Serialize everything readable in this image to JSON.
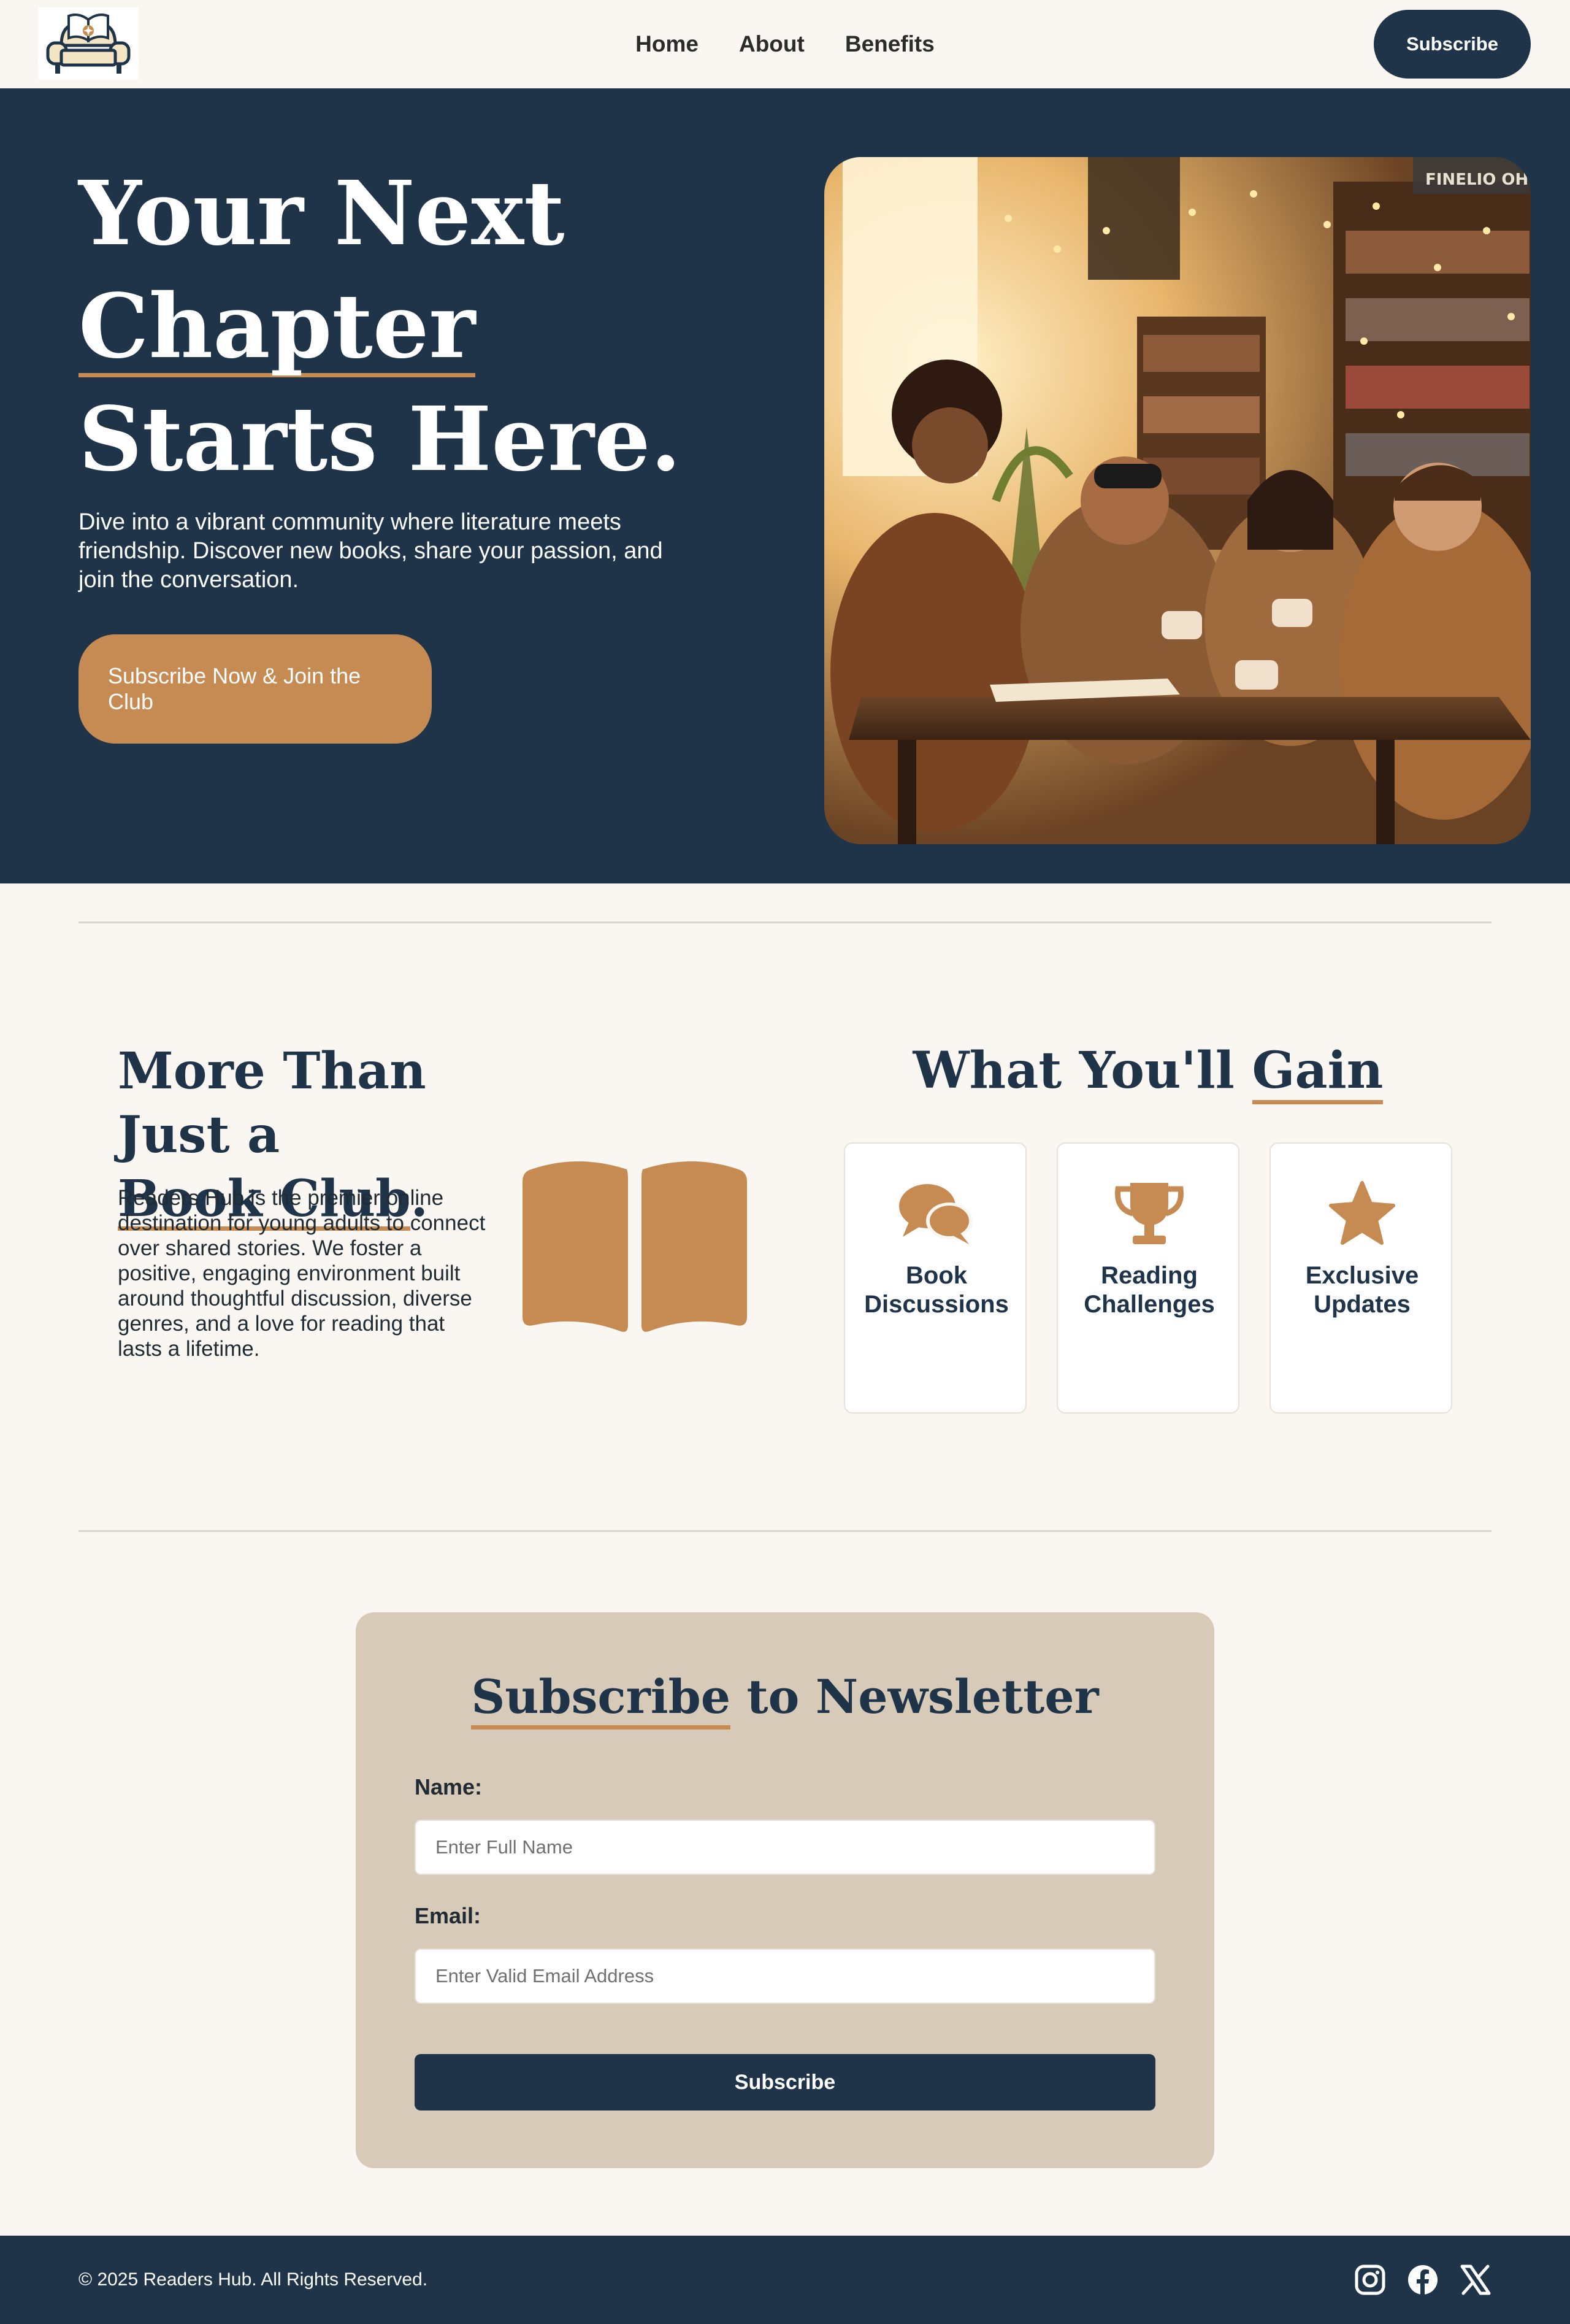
{
  "nav": {
    "logo_name": "armchair-book-logo",
    "links": [
      "Home",
      "About",
      "Benefits"
    ],
    "subscribe_label": "Subscribe"
  },
  "hero": {
    "title_line1": "Your Next",
    "title_line2": "Chapter",
    "title_line3": "Starts Here.",
    "subtitle": "Dive into a vibrant community where literature meets friendship. Discover new books, share your passion, and join the conversation.",
    "cta_label": "Subscribe Now & Join the Club",
    "image_sign_text": "FINELIO OH"
  },
  "about": {
    "title_part1": "More Than Just a ",
    "title_highlight": "Book Club",
    "title_end": ".",
    "text": "Readers Hub is the premier online destination for young adults to connect over shared stories. We foster a positive, engaging environment built around thoughtful discussion, diverse genres, and a love for reading that lasts a lifetime.",
    "icon": "open-book-icon"
  },
  "gain": {
    "title_part1": "What You'll ",
    "title_highlight": "Gain",
    "cards": [
      {
        "icon": "chat-bubbles-icon",
        "label": "Book Discussions"
      },
      {
        "icon": "trophy-icon",
        "label": "Reading Challenges"
      },
      {
        "icon": "star-icon",
        "label": "Exclusive Updates"
      }
    ]
  },
  "newsletter": {
    "title_highlight": "Subscribe",
    "title_rest": " to Newsletter",
    "name_label": "Name:",
    "name_placeholder": "Enter Full Name",
    "email_label": "Email:",
    "email_placeholder": "Enter Valid Email Address",
    "submit_label": "Subscribe"
  },
  "footer": {
    "copyright": "© 2025 Readers Hub. All Rights Reserved.",
    "social": [
      "instagram-icon",
      "facebook-icon",
      "x-icon"
    ]
  },
  "colors": {
    "navy": "#1f3448",
    "accent": "#c68b52",
    "cream": "#faf7f2",
    "card_beige": "#d8cab9"
  }
}
